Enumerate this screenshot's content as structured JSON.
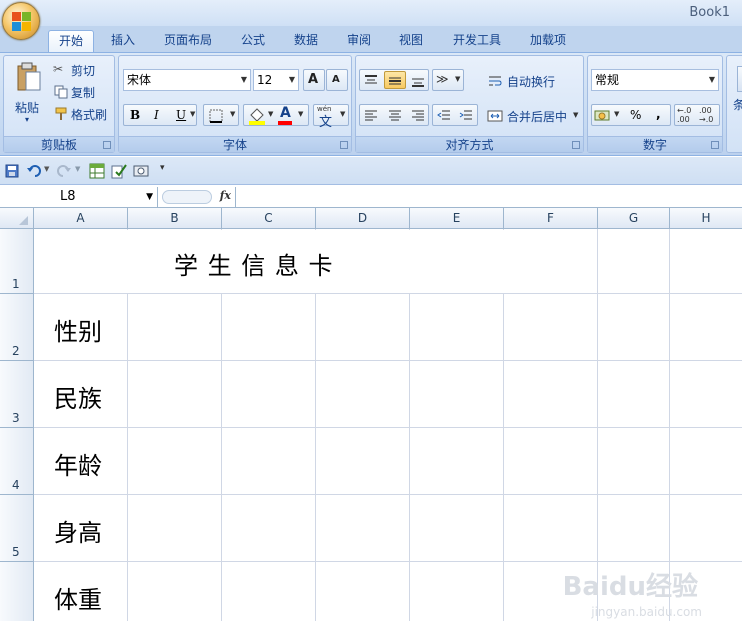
{
  "window": {
    "title": "Book1"
  },
  "tabs": [
    "开始",
    "插入",
    "页面布局",
    "公式",
    "数据",
    "审阅",
    "视图",
    "开发工具",
    "加载项"
  ],
  "clipboard": {
    "paste": "粘贴",
    "cut": "剪切",
    "copy": "复制",
    "format_painter": "格式刷",
    "label": "剪贴板"
  },
  "font": {
    "name": "宋体",
    "size": "12",
    "bold": "B",
    "italic": "I",
    "underline": "U",
    "grow": "A",
    "shrink": "A",
    "font_color": "A",
    "label": "字体"
  },
  "alignment": {
    "wrap": "自动换行",
    "merge": "合并后居中",
    "label": "对齐方式"
  },
  "number": {
    "format": "常规",
    "percent": "%",
    "comma": ",",
    "label": "数字"
  },
  "styles": {
    "partial": "条"
  },
  "formula_bar": {
    "name_box": "L8",
    "fx": "fx",
    "content": ""
  },
  "columns": [
    "A",
    "B",
    "C",
    "D",
    "E",
    "F",
    "G",
    "H"
  ],
  "rows": [
    "1",
    "2",
    "3",
    "4",
    "5",
    "6"
  ],
  "cells": {
    "title": "学 生 信 息 卡",
    "a2": "性别",
    "a3": "民族",
    "a4": "年龄",
    "a5": "身高",
    "a6": "体重"
  },
  "watermark": {
    "brand": "Baidu经验",
    "url": "jingyan.baidu.com"
  },
  "colors": {
    "ribbon": "#c6daf2",
    "tab_text": "#15428b",
    "grid_line": "#d0d7e5",
    "selected": "#f8c961"
  }
}
